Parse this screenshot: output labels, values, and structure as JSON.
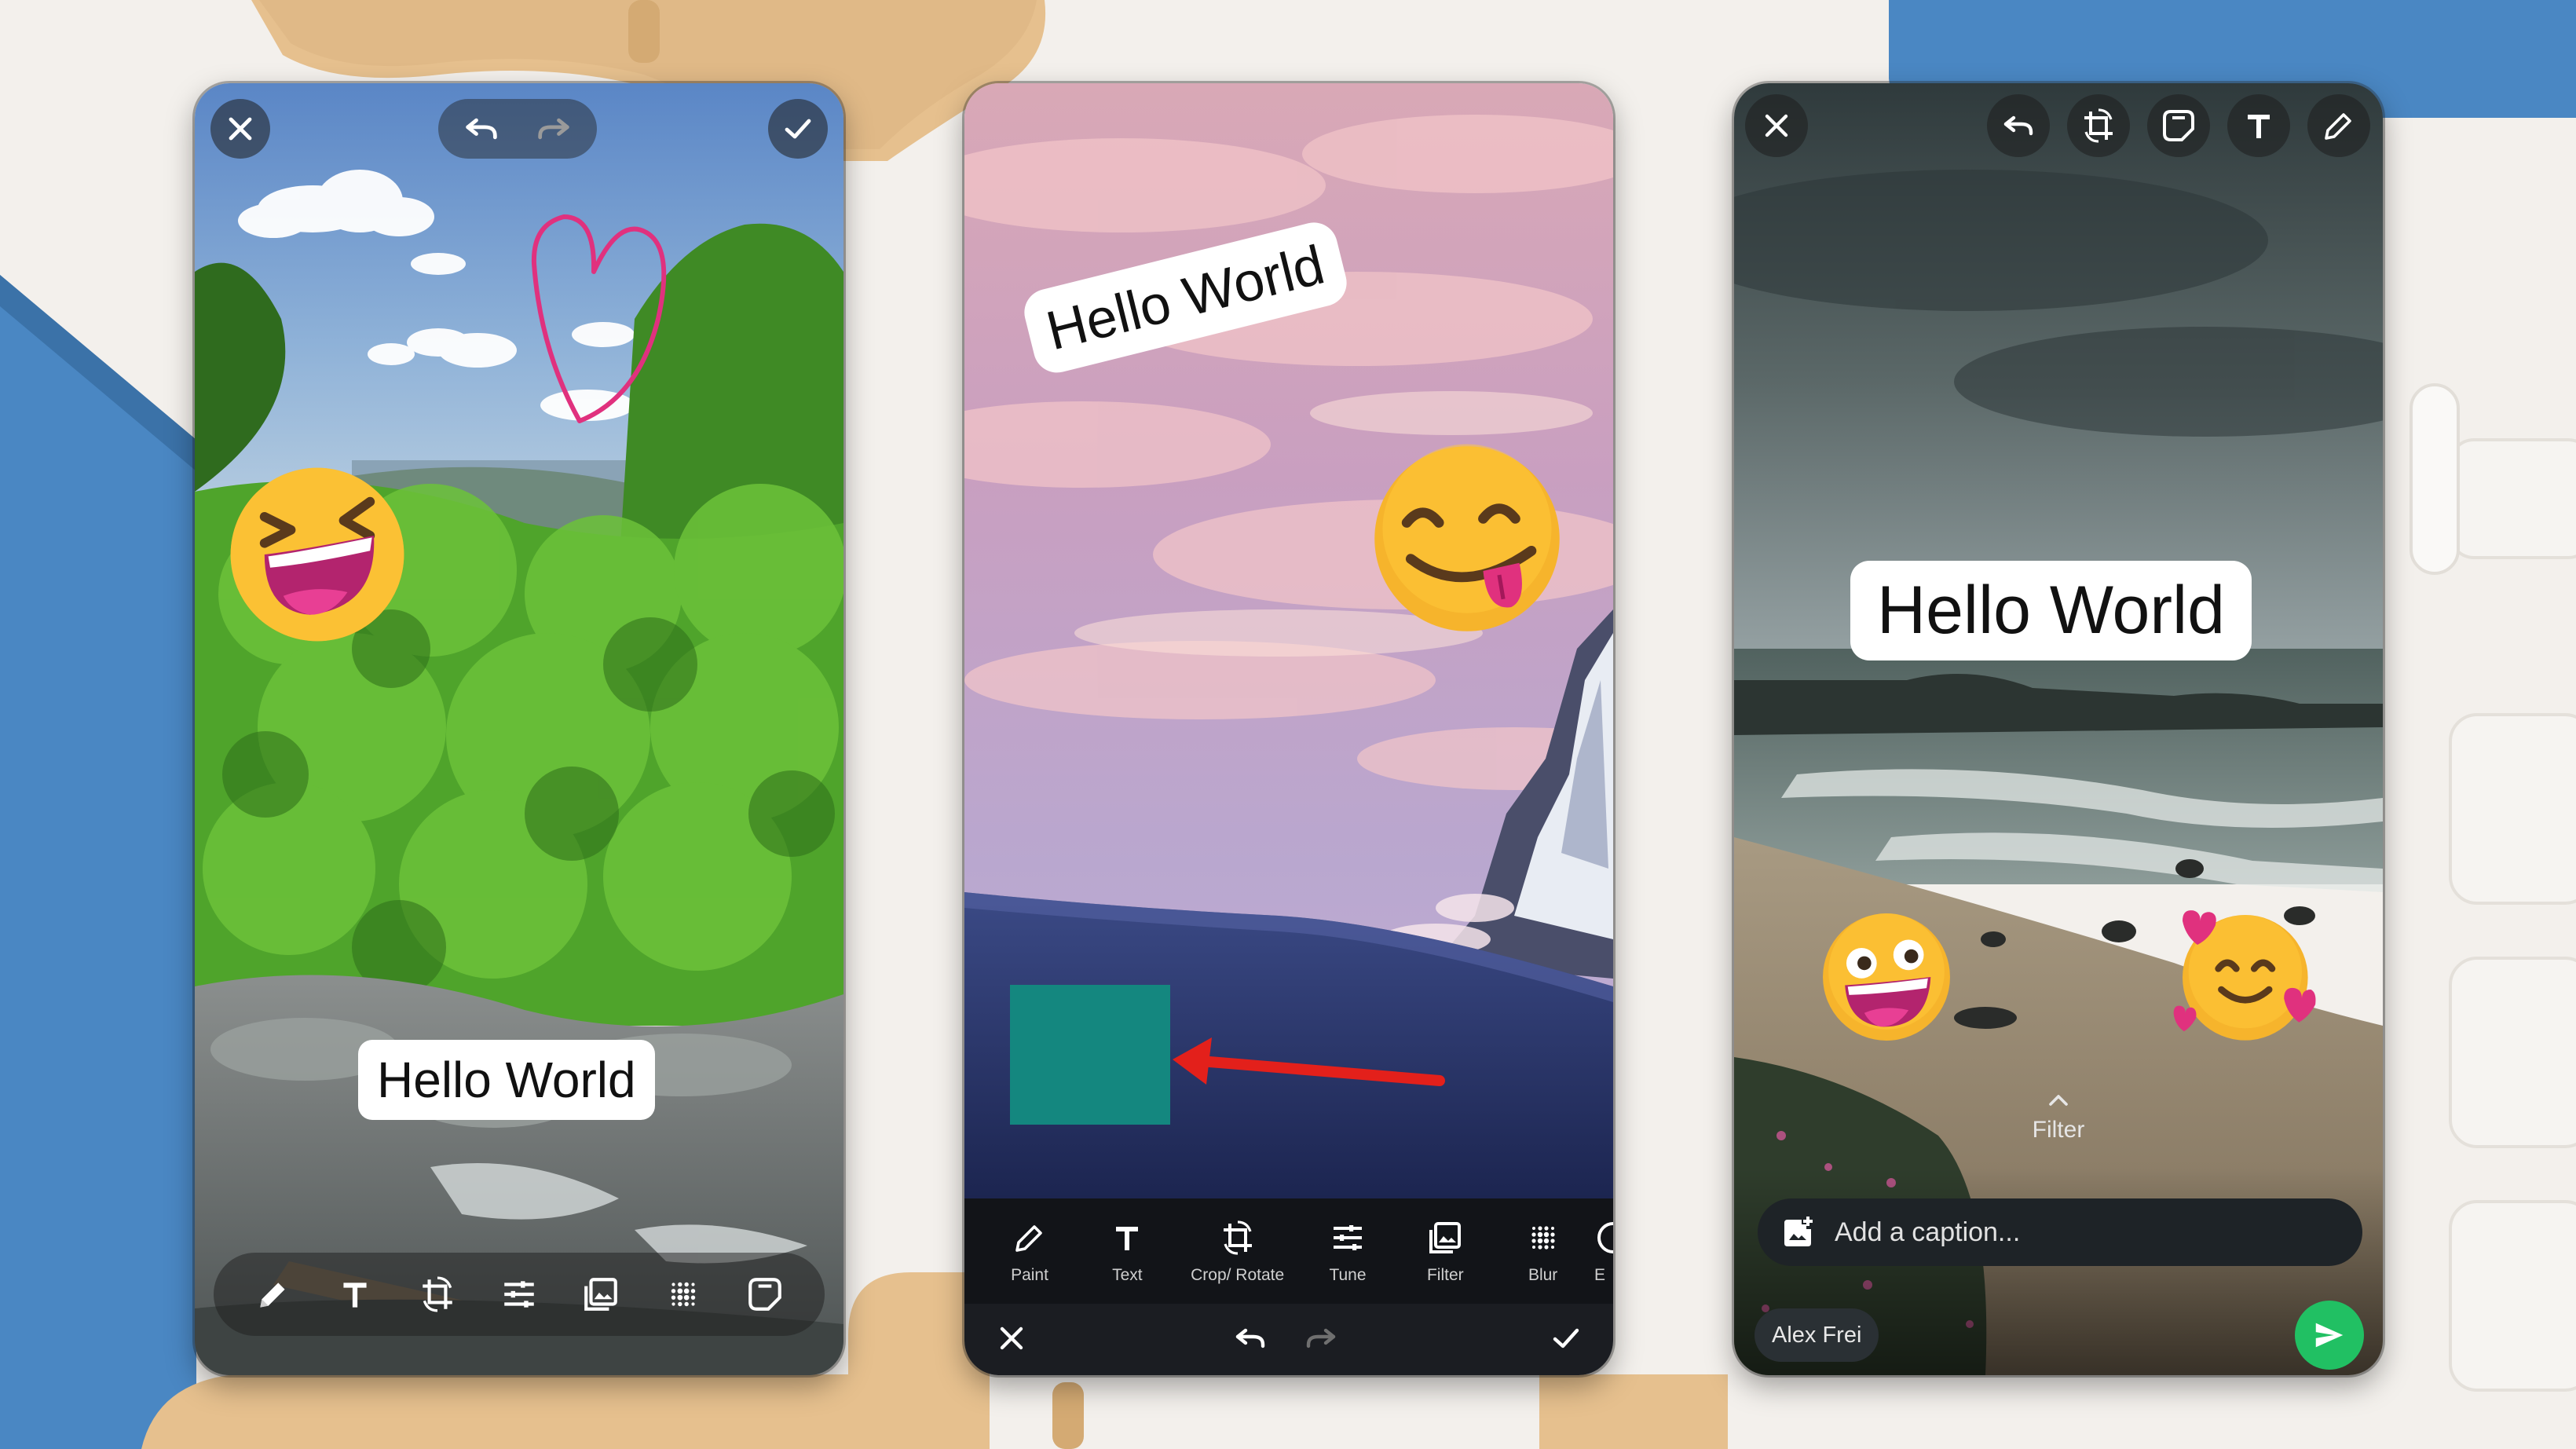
{
  "colors": {
    "page_background": "#f3f0ec",
    "accent_blue": "#4a87c3",
    "accent_tan": "#e6c08e",
    "send_green": "#21c063",
    "rect_teal": "#14877f",
    "arrow_red": "#e3201b",
    "heart_pink": "#e0317e"
  },
  "phone1": {
    "top_bar": {
      "close_icon": "close-icon",
      "undo_icon": "undo-icon",
      "redo_icon": "redo-icon",
      "done_icon": "check-icon"
    },
    "stickers": {
      "text": "Hello World",
      "emoji": "squinting-laughing-face",
      "drawing": "heart-doodle"
    },
    "toolbar_icons": [
      "pencil-icon",
      "text-icon",
      "crop-rotate-icon",
      "tune-icon",
      "filter-icon",
      "blur-icon",
      "sticker-icon"
    ]
  },
  "phone2": {
    "stickers": {
      "text": "Hello World",
      "emoji": "face-savoring-food",
      "shapes": [
        "teal-rectangle",
        "red-arrow"
      ]
    },
    "tools": [
      {
        "icon": "pencil-icon",
        "label": "Paint"
      },
      {
        "icon": "text-icon",
        "label": "Text"
      },
      {
        "icon": "crop-rotate-icon",
        "label": "Crop/ Rotate"
      },
      {
        "icon": "tune-icon",
        "label": "Tune"
      },
      {
        "icon": "filter-icon",
        "label": "Filter"
      },
      {
        "icon": "blur-icon",
        "label": "Blur"
      },
      {
        "icon": "emoji-icon",
        "label": "E"
      }
    ],
    "bottom_bar": {
      "close_icon": "close-icon",
      "undo_icon": "undo-icon",
      "redo_icon": "redo-icon",
      "done_icon": "check-icon"
    }
  },
  "phone3": {
    "top_bar_icons": [
      "close-icon",
      "undo-icon",
      "crop-rotate-icon",
      "sticker-icon",
      "text-icon",
      "pencil-icon"
    ],
    "stickers": {
      "text": "Hello World",
      "emojis": [
        "star-struck-grin-face",
        "smiling-face-with-hearts"
      ]
    },
    "filter_hint": "Filter",
    "caption": {
      "placeholder": "Add a caption..."
    },
    "recipient": "Alex Frei",
    "send_icon": "send-icon"
  }
}
